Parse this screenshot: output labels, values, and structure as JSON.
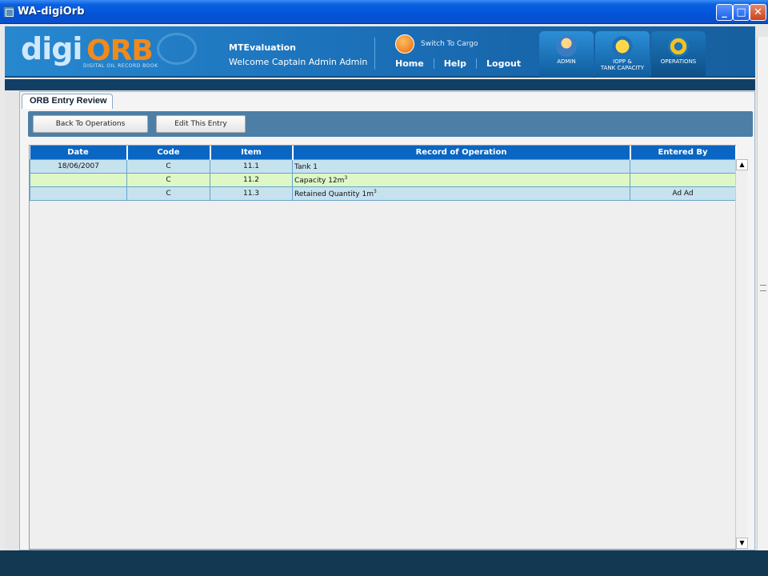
{
  "window": {
    "title": "WA-digiOrb",
    "controls": [
      "_",
      "□",
      "✕"
    ]
  },
  "header": {
    "logo_digi": "digi",
    "logo_orb": "ORB",
    "logo_tagline": "DIGITAL OIL RECORD BOOK",
    "org": "MTEvaluation",
    "welcome": "Welcome Captain Admin Admin",
    "switch_label": "Switch To Cargo",
    "nav": {
      "home": "Home",
      "help": "Help",
      "logout": "Logout"
    },
    "modules": {
      "admin": "ADMIN",
      "iopp_line1": "IOPP &",
      "iopp_line2": "TANK CAPACITY",
      "operations": "OPERATIONS"
    }
  },
  "tab": {
    "label": "ORB Entry Review"
  },
  "toolbar": {
    "back_label": "Back To Operations",
    "edit_label": "Edit This Entry"
  },
  "grid": {
    "headers": [
      "Date",
      "Code",
      "Item",
      "Record of Operation",
      "Entered By"
    ],
    "rows": [
      {
        "date": "18/06/2007",
        "code": "C",
        "item": "11.1",
        "record": "Tank 1",
        "record_sup": "",
        "entered_by": ""
      },
      {
        "date": "",
        "code": "C",
        "item": "11.2",
        "record": "Capacity 12m",
        "record_sup": "3",
        "entered_by": ""
      },
      {
        "date": "",
        "code": "C",
        "item": "11.3",
        "record": "Retained Quantity 1m",
        "record_sup": "3",
        "entered_by": "Ad Ad"
      }
    ]
  },
  "colors": {
    "header_blue": "#0a66c2",
    "row_blue": "#c6e2ef",
    "row_green": "#def7c7",
    "toolbar": "#4d7fa6",
    "accent_orange": "#f08a1c"
  }
}
